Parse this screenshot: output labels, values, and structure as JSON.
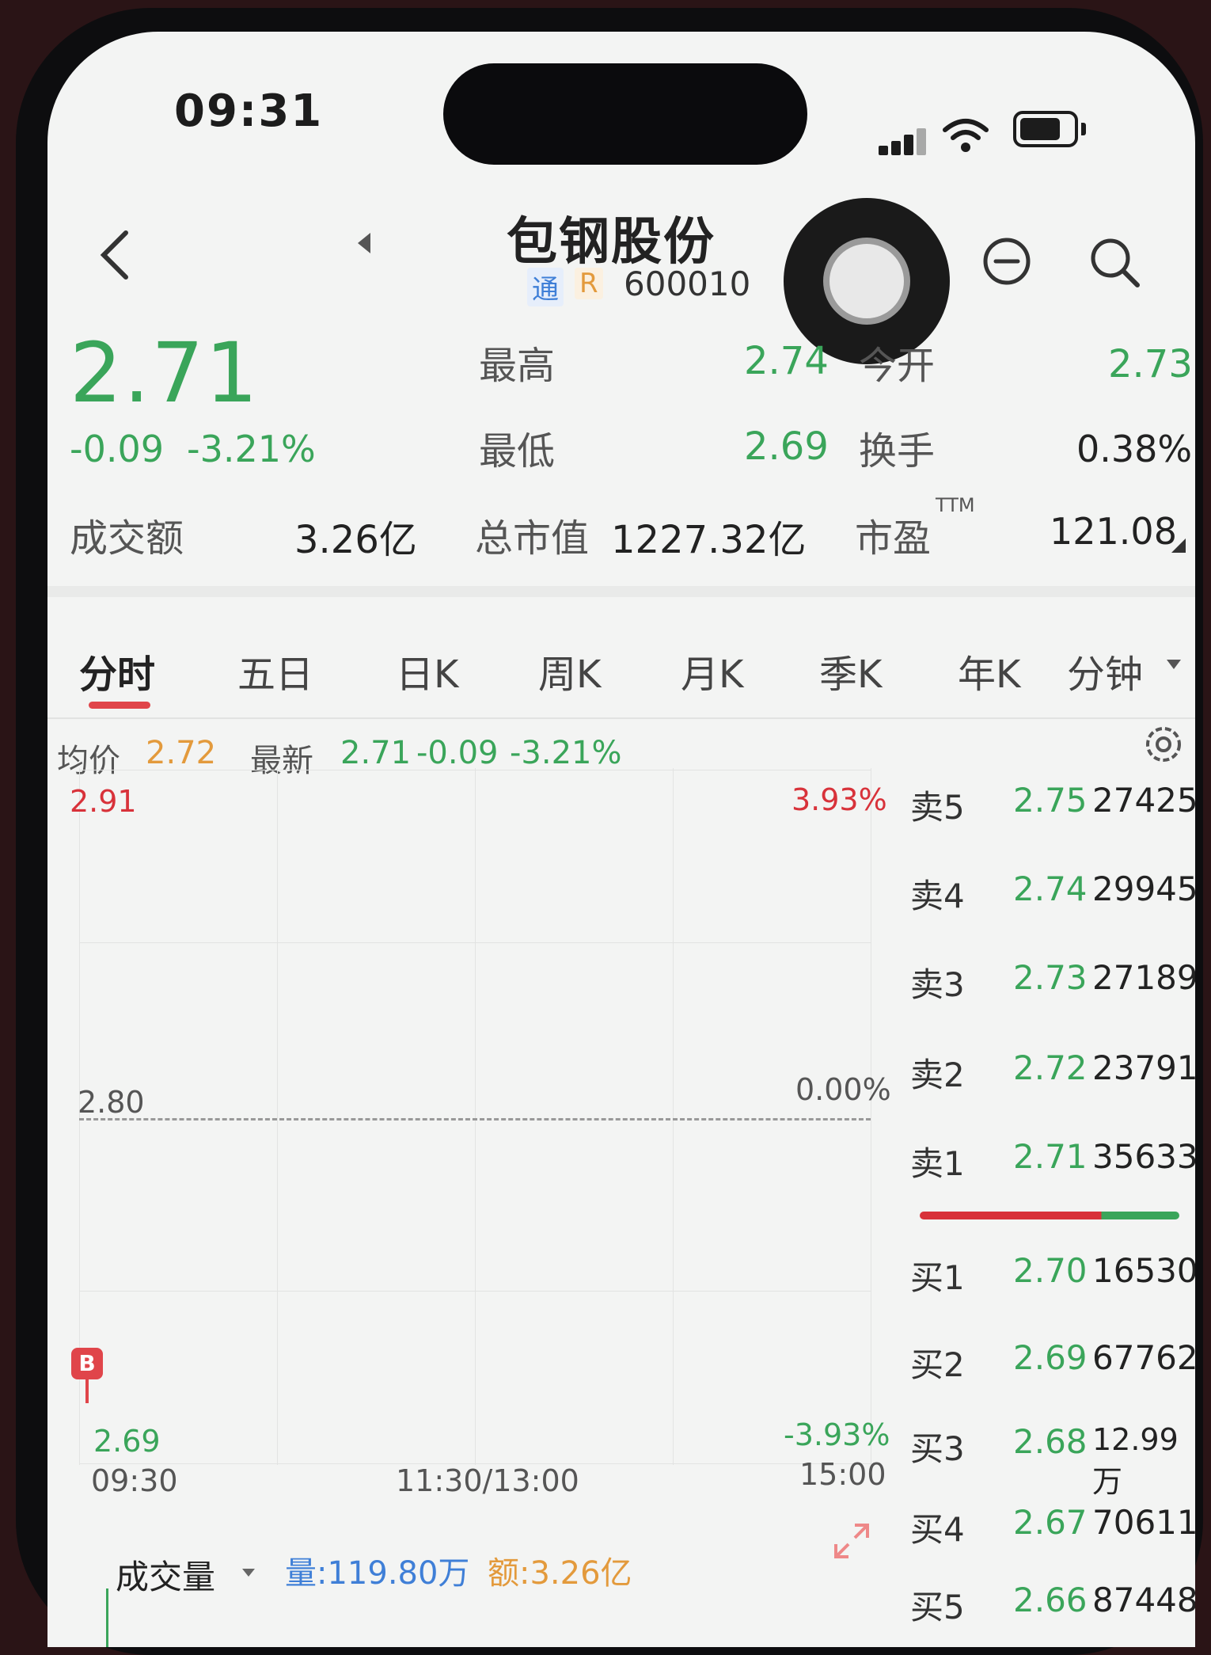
{
  "status_bar": {
    "time": "09:31"
  },
  "header": {
    "stock_name": "包钢股份",
    "badge_tong": "通",
    "badge_r": "R",
    "stock_code": "600010"
  },
  "quote": {
    "price": "2.71",
    "change": "-0.09",
    "change_pct": "-3.21%",
    "high_label": "最高",
    "high_value": "2.74",
    "open_label": "今开",
    "open_value": "2.73",
    "low_label": "最低",
    "low_value": "2.69",
    "turnover_label": "换手",
    "turnover_value": "0.38%",
    "amount_label": "成交额",
    "amount_value": "3.26亿",
    "market_cap_label": "总市值",
    "market_cap_value": "1227.32亿",
    "pe_label": "市盈",
    "pe_sup": "TTM",
    "pe_value": "121.08"
  },
  "tabs": [
    "分时",
    "五日",
    "日K",
    "周K",
    "月K",
    "季K",
    "年K",
    "分钟"
  ],
  "chart_info": {
    "avg_label": "均价",
    "avg_value": "2.72",
    "latest_label": "最新",
    "latest_value": "2.71",
    "latest_change": "-0.09",
    "latest_pct": "-3.21%"
  },
  "chart_axes": {
    "y_top": "2.91",
    "y_mid": "2.80",
    "y_bottom": "2.69",
    "pct_top": "3.93%",
    "pct_mid": "0.00%",
    "pct_bottom": "-3.93%",
    "x_start": "09:30",
    "x_mid": "11:30/13:00",
    "x_end": "15:00",
    "marker": "B"
  },
  "volume_bar": {
    "label": "成交量",
    "volume": "量:119.80万",
    "amount": "额:3.26亿"
  },
  "order_book": {
    "asks": [
      {
        "label": "卖5",
        "price": "2.75",
        "volume": "27425"
      },
      {
        "label": "卖4",
        "price": "2.74",
        "volume": "29945"
      },
      {
        "label": "卖3",
        "price": "2.73",
        "volume": "27189"
      },
      {
        "label": "卖2",
        "price": "2.72",
        "volume": "23791"
      },
      {
        "label": "卖1",
        "price": "2.71",
        "volume": "35633"
      }
    ],
    "bids": [
      {
        "label": "买1",
        "price": "2.70",
        "volume": "16530"
      },
      {
        "label": "买2",
        "price": "2.69",
        "volume": "67762"
      },
      {
        "label": "买3",
        "price": "2.68",
        "volume": "12.99万"
      },
      {
        "label": "买4",
        "price": "2.67",
        "volume": "70611"
      },
      {
        "label": "买5",
        "price": "2.66",
        "volume": "87448"
      }
    ]
  },
  "colors": {
    "up": "#d8323a",
    "down": "#3aa55a",
    "avg": "#e39a3c",
    "accent": "#e0454a"
  }
}
